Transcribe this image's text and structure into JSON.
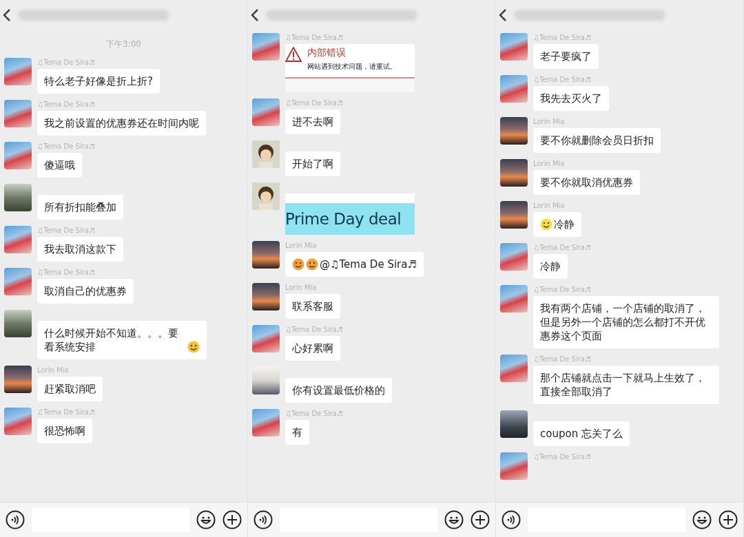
{
  "panels": [
    {
      "timestamp": "下午3:00",
      "messages": [
        {
          "kind": "text",
          "avatar": {
            "kind": "beach"
          },
          "sender": "♫Tema De Sira♬",
          "text": "特么老子好像是折上折?"
        },
        {
          "kind": "text",
          "avatar": {
            "kind": "beach"
          },
          "sender": "♫Tema De Sira♬",
          "text": "我之前设置的优惠券还在时间内呢"
        },
        {
          "kind": "text",
          "avatar": {
            "kind": "beach"
          },
          "sender": "♫Tema De Sira♬",
          "text": "傻逼哦"
        },
        {
          "kind": "text",
          "avatar": {
            "kind": "trees"
          },
          "text": "所有折扣能叠加"
        },
        {
          "kind": "text",
          "avatar": {
            "kind": "beach"
          },
          "sender": "♫Tema De Sira♬",
          "text": "我去取消这款下"
        },
        {
          "kind": "text",
          "avatar": {
            "kind": "beach"
          },
          "sender": "♫Tema De Sira♬",
          "text": "取消自己的优惠券"
        },
        {
          "kind": "text",
          "avatar": {
            "kind": "trees"
          },
          "text": "什么时候开始不知道。。。要看系统安排",
          "emojis_after": [
            {
              "kind": "grin"
            }
          ]
        },
        {
          "kind": "text",
          "avatar": {
            "kind": "sunset"
          },
          "sender": "Lorin Mia",
          "text": "赶紧取消吧"
        },
        {
          "kind": "text",
          "avatar": {
            "kind": "beach"
          },
          "sender": "♫Tema De Sira♬",
          "text": "很恐怖啊"
        }
      ]
    },
    {
      "messages": [
        {
          "kind": "error",
          "avatar": {
            "kind": "beach"
          },
          "sender": "♫Tema De Sira♬",
          "title": "内部错误",
          "text": "网站遇到技术问题，请重试。"
        },
        {
          "kind": "text",
          "avatar": {
            "kind": "beach"
          },
          "sender": "♫Tema De Sira♬",
          "text": "进不去啊"
        },
        {
          "kind": "text",
          "avatar": {
            "kind": "cartoon"
          },
          "text": "开始了啊"
        },
        {
          "kind": "image",
          "avatar": {
            "kind": "cartoon"
          },
          "text": "Prime Day deal"
        },
        {
          "kind": "text",
          "avatar": {
            "kind": "sunset"
          },
          "sender": "Lorin Mia",
          "text": "@♫Tema De Sira♬",
          "emojis_before": [
            {
              "kind": "flushed"
            },
            {
              "kind": "flushed"
            }
          ]
        },
        {
          "kind": "text",
          "avatar": {
            "kind": "sunset"
          },
          "sender": "Lorin Mia",
          "text": "联系客服"
        },
        {
          "kind": "text",
          "avatar": {
            "kind": "beach"
          },
          "sender": "♫Tema De Sira♬",
          "text": "心好累啊"
        },
        {
          "kind": "text",
          "avatar": {
            "kind": "suit"
          },
          "text": "你有设置最低价格的"
        },
        {
          "kind": "text",
          "avatar": {
            "kind": "beach"
          },
          "sender": "♫Tema De Sira♬",
          "text": "有"
        }
      ]
    },
    {
      "messages": [
        {
          "kind": "text",
          "avatar": {
            "kind": "beach"
          },
          "sender": "♫Tema De Sira♬",
          "text": "老子要疯了"
        },
        {
          "kind": "text",
          "avatar": {
            "kind": "beach"
          },
          "sender": "♫Tema De Sira♬",
          "text": "我先去灭火了"
        },
        {
          "kind": "text",
          "avatar": {
            "kind": "sunset"
          },
          "sender": "Lorin Mia",
          "text": "要不你就删除会员日折扣"
        },
        {
          "kind": "text",
          "avatar": {
            "kind": "sunset"
          },
          "sender": "Lorin Mia",
          "text": "要不你就取消优惠券"
        },
        {
          "kind": "text",
          "avatar": {
            "kind": "sunset"
          },
          "sender": "Lorin Mia",
          "text": "冷静",
          "emojis_before": [
            {
              "kind": "laugh"
            }
          ]
        },
        {
          "kind": "text",
          "avatar": {
            "kind": "beach"
          },
          "sender": "♫Tema De Sira♬",
          "text": "冷静"
        },
        {
          "kind": "text",
          "avatar": {
            "kind": "beach"
          },
          "sender": "♫Tema De Sira♬",
          "text": "我有两个店铺，一个店铺的取消了，但是另外一个店铺的怎么都打不开优惠券这个页面"
        },
        {
          "kind": "text",
          "avatar": {
            "kind": "beach"
          },
          "sender": "♫Tema De Sira♬",
          "text": "那个店铺就点击一下就马上生效了，直接全部取消了"
        },
        {
          "kind": "text",
          "avatar": {
            "kind": "dark"
          },
          "text": "coupon 忘关了么"
        },
        {
          "kind": "text",
          "avatar": {
            "kind": "beach"
          },
          "sender": "♫Tema De Sira♬"
        }
      ]
    }
  ]
}
